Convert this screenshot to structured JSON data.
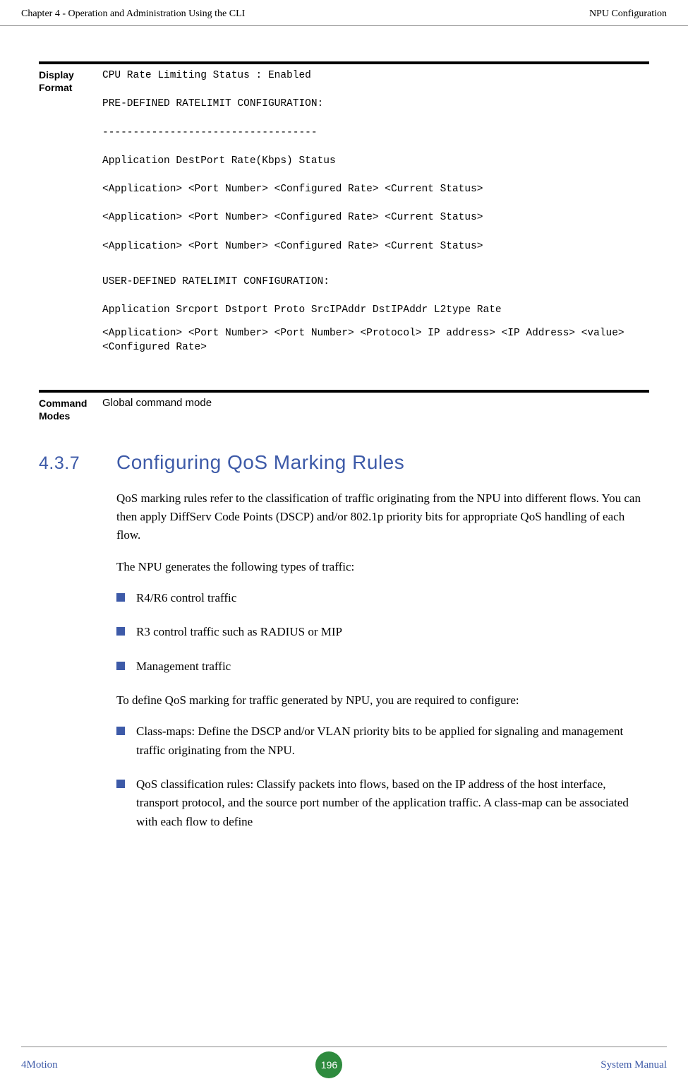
{
  "header": {
    "left": "Chapter 4 - Operation and Administration Using the CLI",
    "right": "NPU Configuration"
  },
  "display_format": {
    "label": "Display Format",
    "line1": "CPU Rate Limiting Status : Enabled",
    "line2": "PRE-DEFINED RATELIMIT CONFIGURATION:",
    "line3": "-----------------------------------",
    "line4": "Application   DestPort      Rate(Kbps)    Status",
    "line5": "<Application>  <Port Number>  <Configured Rate> <Current Status>",
    "line6": "<Application>  <Port Number>  <Configured Rate> <Current Status>",
    "line7": "<Application>  <Port Number>  <Configured Rate> <Current Status>",
    "line8": "USER-DEFINED RATELIMIT CONFIGURATION:",
    "line9": "Application  Srcport    Dstport     Proto       SrcIPAddr   DstIPAddr   L2type    Rate",
    "line10": "<Application> <Port Number> <Port Number>  <Protocol>    IP address> <IP Address>   <value>    <Configured Rate>"
  },
  "command_modes": {
    "label": "Command Modes",
    "text": "Global command mode"
  },
  "section": {
    "number": "4.3.7",
    "title": "Configuring QoS Marking Rules"
  },
  "body": {
    "p1": "QoS marking rules refer to the classification of traffic originating from the NPU into different flows. You can then apply DiffServ Code Points (DSCP) and/or 802.1p priority bits for appropriate QoS handling of each flow.",
    "p2": "The NPU generates the following types of traffic:",
    "bullets1": {
      "b1": "R4/R6 control traffic",
      "b2": "R3 control traffic such as RADIUS or MIP",
      "b3": "Management traffic"
    },
    "p3": "To define QoS marking for traffic generated by NPU, you are required to configure:",
    "bullets2": {
      "b1": "Class-maps: Define the DSCP and/or VLAN priority bits to be applied for signaling and management traffic originating from the NPU.",
      "b2": "QoS classification rules: Classify packets into flows, based on the IP address of the host interface, transport protocol, and the source port number of the application traffic. A class-map can be associated with each flow to define"
    }
  },
  "footer": {
    "left": "4Motion",
    "page": "196",
    "right": "System Manual"
  }
}
